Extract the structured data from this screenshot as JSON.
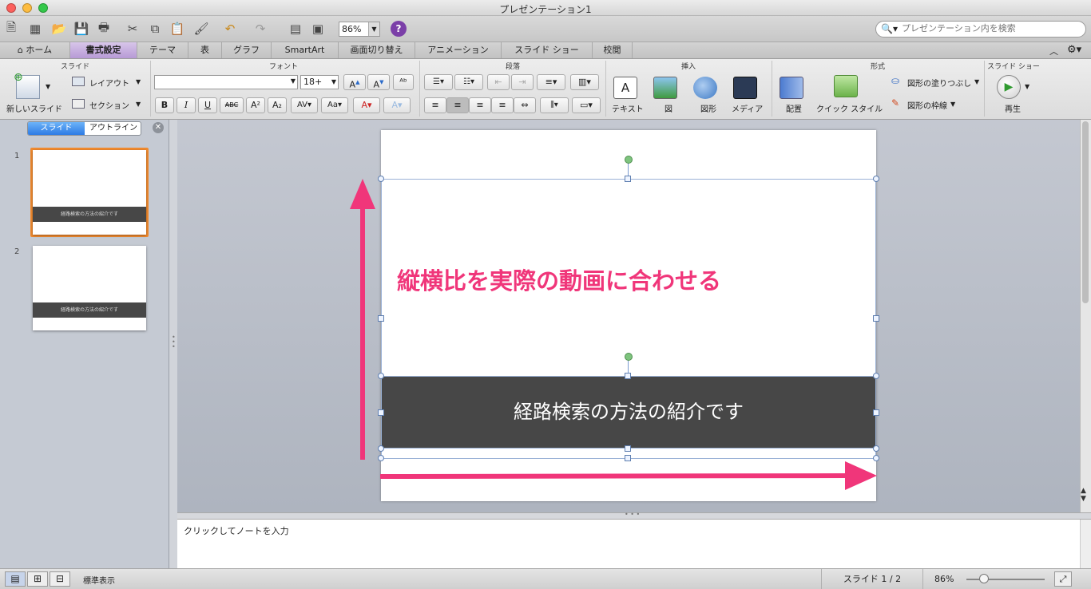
{
  "window": {
    "title": "プレゼンテーション1"
  },
  "toolbar": {
    "zoom": "86%",
    "search_placeholder": "プレゼンテーション内を検索"
  },
  "tabs": [
    {
      "label": "ホーム"
    },
    {
      "label": "書式設定"
    },
    {
      "label": "テーマ"
    },
    {
      "label": "表"
    },
    {
      "label": "グラフ"
    },
    {
      "label": "SmartArt"
    },
    {
      "label": "画面切り替え"
    },
    {
      "label": "アニメーション"
    },
    {
      "label": "スライド ショー"
    },
    {
      "label": "校閲"
    }
  ],
  "ribbon": {
    "groups": {
      "slides": "スライド",
      "font": "フォント",
      "paragraph": "段落",
      "insert": "挿入",
      "format": "形式",
      "slideshow": "スライド ショー"
    },
    "new_slide": "新しいスライド",
    "layout": "レイアウト",
    "section": "セクション",
    "font_size": "18+",
    "font_buttons": {
      "bold": "B",
      "italic": "I",
      "underline": "U",
      "strike": "ABC",
      "superscript": "A²",
      "subscript": "A₂"
    },
    "insert": {
      "text": "テキスト",
      "picture": "図",
      "shape": "図形",
      "media": "メディア"
    },
    "format": {
      "arrange": "配置",
      "quick_style": "クイック スタイル",
      "fill": "図形の塗りつぶし",
      "line": "図形の枠線"
    },
    "play": "再生"
  },
  "left_panel": {
    "tab_slides": "スライド",
    "tab_outline": "アウトライン",
    "thumbnails": [
      {
        "num": "1",
        "caption": "経路検索の方法の紹介です"
      },
      {
        "num": "2",
        "caption": "経路検索の方法の紹介です"
      }
    ]
  },
  "slide": {
    "subtitle": "経路検索の方法の紹介です",
    "annotation": "縦横比を実際の動画に合わせる"
  },
  "notes": {
    "placeholder": "クリックしてノートを入力"
  },
  "status": {
    "view_label": "標準表示",
    "slide_info": "スライド 1 / 2",
    "zoom": "86%"
  },
  "colors": {
    "annotation": "#f0367a",
    "subtitle_bar": "#474747",
    "active_tab": "#b79ad6",
    "selection_orange": "#f28b2f"
  }
}
